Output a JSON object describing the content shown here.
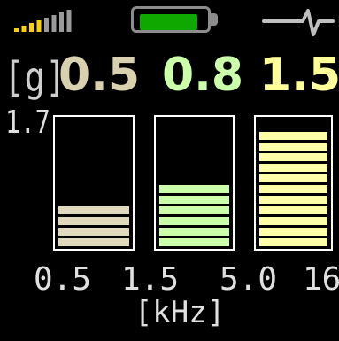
{
  "status": {
    "signal_bars": 8,
    "signal_active_bars": 4,
    "battery_level": 0.85
  },
  "colors": {
    "bar1": "#e0d9bc",
    "bar2": "#ccffaa",
    "bar3": "#ffffaa",
    "signal_active": "#ffd000",
    "signal_inactive": "#9a9a9a",
    "battery": "#0ea800"
  },
  "icons": [
    "signal-strength-icon",
    "battery-icon",
    "pulse-waveform-icon"
  ],
  "readout": {
    "unit": "[g]",
    "values": [
      "0.5",
      "0.8",
      "1.5"
    ]
  },
  "chart_data": {
    "type": "bar",
    "ymax_label": "1.7",
    "ylim": [
      0,
      1.7
    ],
    "x_ticks": [
      "0.5",
      "1.5",
      "5.0",
      "16"
    ],
    "xlabel": "[kHz]",
    "categories": [
      "0.5-1.5",
      "1.5-5.0",
      "5.0-16"
    ],
    "values": [
      0.5,
      0.8,
      1.5
    ],
    "grid": false
  }
}
